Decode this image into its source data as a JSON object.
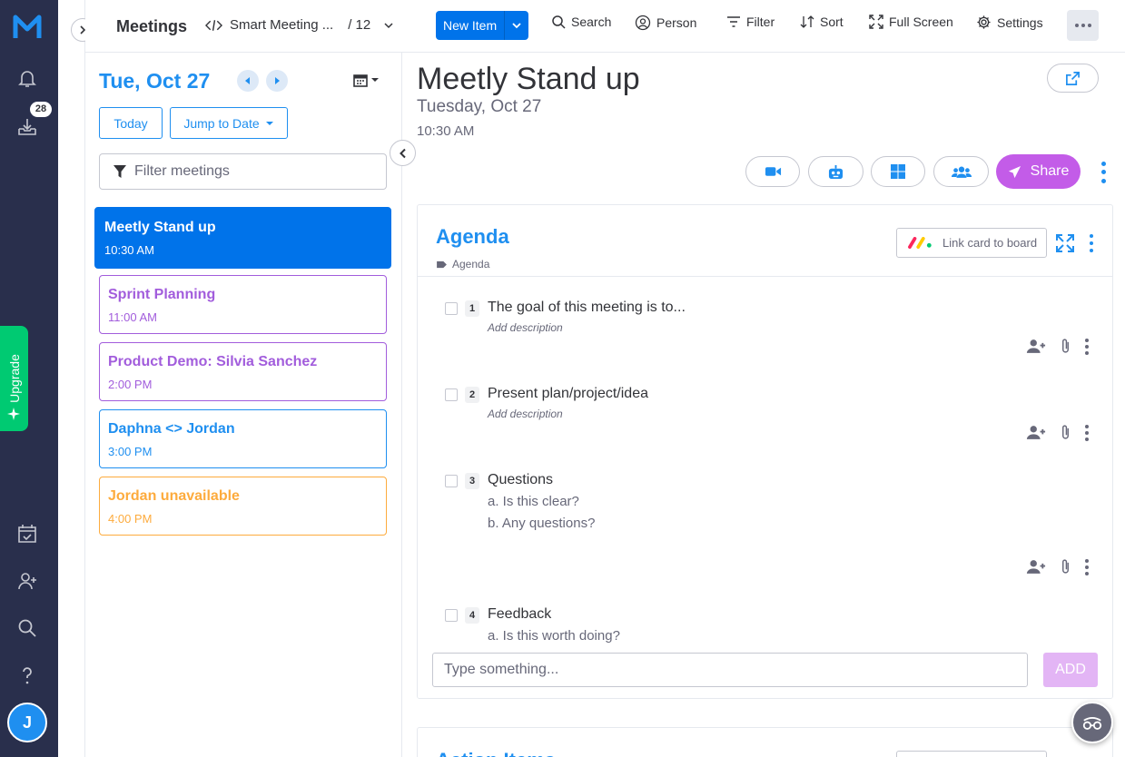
{
  "rail": {
    "notifications_badge": "28",
    "avatar_initial": "J",
    "upgrade_label": "Upgrade"
  },
  "header": {
    "board_title": "Meetings",
    "view_name": "Smart Meeting ...",
    "view_count": "/ 12",
    "new_item_label": "New Item",
    "search_label": "Search",
    "person_label": "Person",
    "filter_label": "Filter",
    "sort_label": "Sort",
    "fullscreen_label": "Full Screen",
    "settings_label": "Settings"
  },
  "list": {
    "date_title": "Tue, Oct 27",
    "today_label": "Today",
    "jump_label": "Jump to Date",
    "filter_placeholder": "Filter meetings",
    "meetings": [
      {
        "title": "Meetly Stand up",
        "time": "10:30 AM",
        "color": "#0073ea",
        "active": true
      },
      {
        "title": "Sprint Planning",
        "time": "11:00 AM",
        "color": "#a25ddc",
        "active": false
      },
      {
        "title": "Product Demo: Silvia Sanchez",
        "time": "2:00 PM",
        "color": "#a25ddc",
        "active": false
      },
      {
        "title": "Daphna <> Jordan",
        "time": "3:00 PM",
        "color": "#1f8ff0",
        "active": false
      },
      {
        "title": "Jordan unavailable",
        "time": "4:00 PM",
        "color": "#fdab3d",
        "active": false
      }
    ]
  },
  "detail": {
    "title": "Meetly Stand up",
    "date": "Tuesday, Oct 27",
    "time": "10:30 AM",
    "share_label": "Share",
    "agenda": {
      "title": "Agenda",
      "tag": "Agenda",
      "link_card_label": "Link card to board",
      "items": [
        {
          "num": "1",
          "text": "The goal of this meeting is to...",
          "desc": "Add description",
          "subs": []
        },
        {
          "num": "2",
          "text": "Present plan/project/idea",
          "desc": "Add description",
          "subs": []
        },
        {
          "num": "3",
          "text": "Questions",
          "desc": "",
          "subs": [
            "a. Is this clear?",
            "b. Any questions?"
          ]
        },
        {
          "num": "4",
          "text": "Feedback",
          "desc": "",
          "subs": [
            "a. Is this worth doing?"
          ]
        }
      ],
      "add_placeholder": "Type something...",
      "add_label": "ADD"
    },
    "next_section_title": "Action Items"
  },
  "colors": {
    "rail_bg": "#292f4c",
    "primary": "#0073ea",
    "link_blue": "#1f8ff0",
    "share_purple": "#c35ce8",
    "upgrade_green": "#00ca72"
  },
  "icons": [
    "monday-logo-icon",
    "bell-icon",
    "inbox-download-icon",
    "calendar-check-icon",
    "add-person-icon",
    "search-icon",
    "help-icon",
    "sparkle-icon",
    "chevron-right-icon",
    "code-icon",
    "chevron-down-icon",
    "person-circle-icon",
    "filter-icon",
    "sort-icon",
    "fullscreen-icon",
    "gear-icon",
    "more-horizontal-icon",
    "caret-left-icon",
    "caret-right-icon",
    "calendar-icon",
    "funnel-icon",
    "chevron-left-icon",
    "external-link-icon",
    "video-icon",
    "robot-icon",
    "windows-icon",
    "users-icon",
    "paper-plane-icon",
    "tag-icon",
    "monday-color-logo-icon",
    "expand-arrows-icon",
    "add-user-icon",
    "paperclip-icon",
    "more-vertical-icon",
    "glasses-icon"
  ]
}
